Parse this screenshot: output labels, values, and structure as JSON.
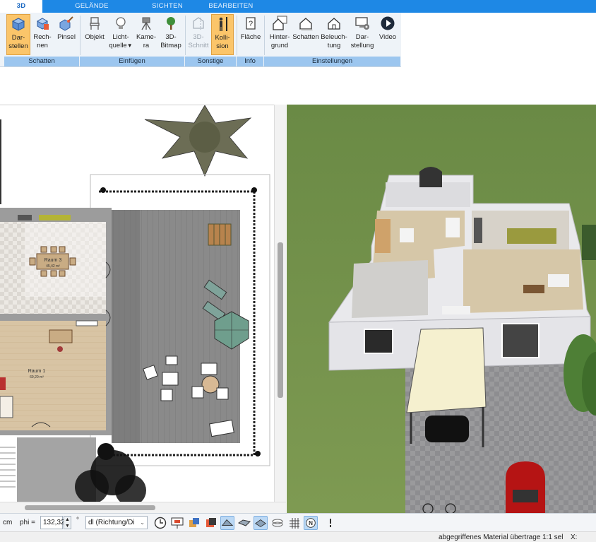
{
  "tabs": [
    {
      "label": "3D",
      "active": true
    },
    {
      "label": "GELÄNDE",
      "active": false
    },
    {
      "label": "SICHTEN",
      "active": false
    },
    {
      "label": "BEARBEITEN",
      "active": false
    }
  ],
  "ribbon": {
    "buttons": {
      "darstellen": {
        "line1": "Dar-",
        "line2": "stellen",
        "icon": "cube-render-icon",
        "active": true
      },
      "rechnen": {
        "line1": "Rech-",
        "line2": "nen",
        "icon": "cube-calc-icon"
      },
      "pinsel": {
        "line1": "Pinsel",
        "line2": "",
        "icon": "brush-cube-icon"
      },
      "objekt": {
        "line1": "Objekt",
        "line2": "",
        "icon": "chair-icon"
      },
      "lichtquelle": {
        "line1": "Licht-",
        "line2": "quelle",
        "icon": "lightbulb-icon",
        "has_dropdown": true
      },
      "kamera": {
        "line1": "Kame-",
        "line2": "ra",
        "icon": "camera-icon"
      },
      "bitmap3d": {
        "line1": "3D-",
        "line2": "Bitmap",
        "icon": "tree-icon"
      },
      "schnitt3d": {
        "line1": "3D-",
        "line2": "Schnitt",
        "icon": "section-icon",
        "disabled": true
      },
      "kollision": {
        "line1": "Kolli-",
        "line2": "sion",
        "icon": "person-icon",
        "active": true
      },
      "flaeche": {
        "line1": "Fläche",
        "line2": "",
        "icon": "area-help-icon"
      },
      "hintergrund": {
        "line1": "Hinter-",
        "line2": "grund",
        "icon": "house-background-icon"
      },
      "schatten": {
        "line1": "Schatten",
        "line2": "",
        "icon": "house-shadow-icon"
      },
      "beleuchtung": {
        "line1": "Beleuch-",
        "line2": "tung",
        "icon": "house-light-icon"
      },
      "darstellung": {
        "line1": "Dar-",
        "line2": "stellung",
        "icon": "monitor-settings-icon"
      },
      "video": {
        "line1": "Video",
        "line2": "",
        "icon": "play-icon"
      }
    },
    "groups": {
      "schatten": "Schatten",
      "einfuegen": "Einfügen",
      "sonstige": "Sonstige",
      "info": "Info",
      "einstellungen": "Einstellungen"
    },
    "colors": {
      "active_bg": "#fbc56a",
      "group_bar": "#9cc6ef",
      "tab_bar": "#1e88e5"
    }
  },
  "plan": {
    "rooms": [
      {
        "name": "Raum 3",
        "area": "45,42 m²"
      },
      {
        "name": "Raum 1",
        "area": "69,20 m²"
      }
    ]
  },
  "toolbar": {
    "unit": "cm",
    "phi_label": "phi =",
    "phi_value": "132,32",
    "phi_unit": "°",
    "direction_select": "dl (Richtung/Di",
    "icons": [
      "clock-icon",
      "presentation-icon",
      "paint-icon",
      "view-front-icon",
      "view-side-icon",
      "view-top-icon",
      "view-perspective-icon",
      "grid-icon",
      "north-icon",
      "more-icon"
    ]
  },
  "status": {
    "message": "abgegriffenes Material übertrage",
    "scale": "1:1 sel",
    "coord_label": "X:"
  }
}
